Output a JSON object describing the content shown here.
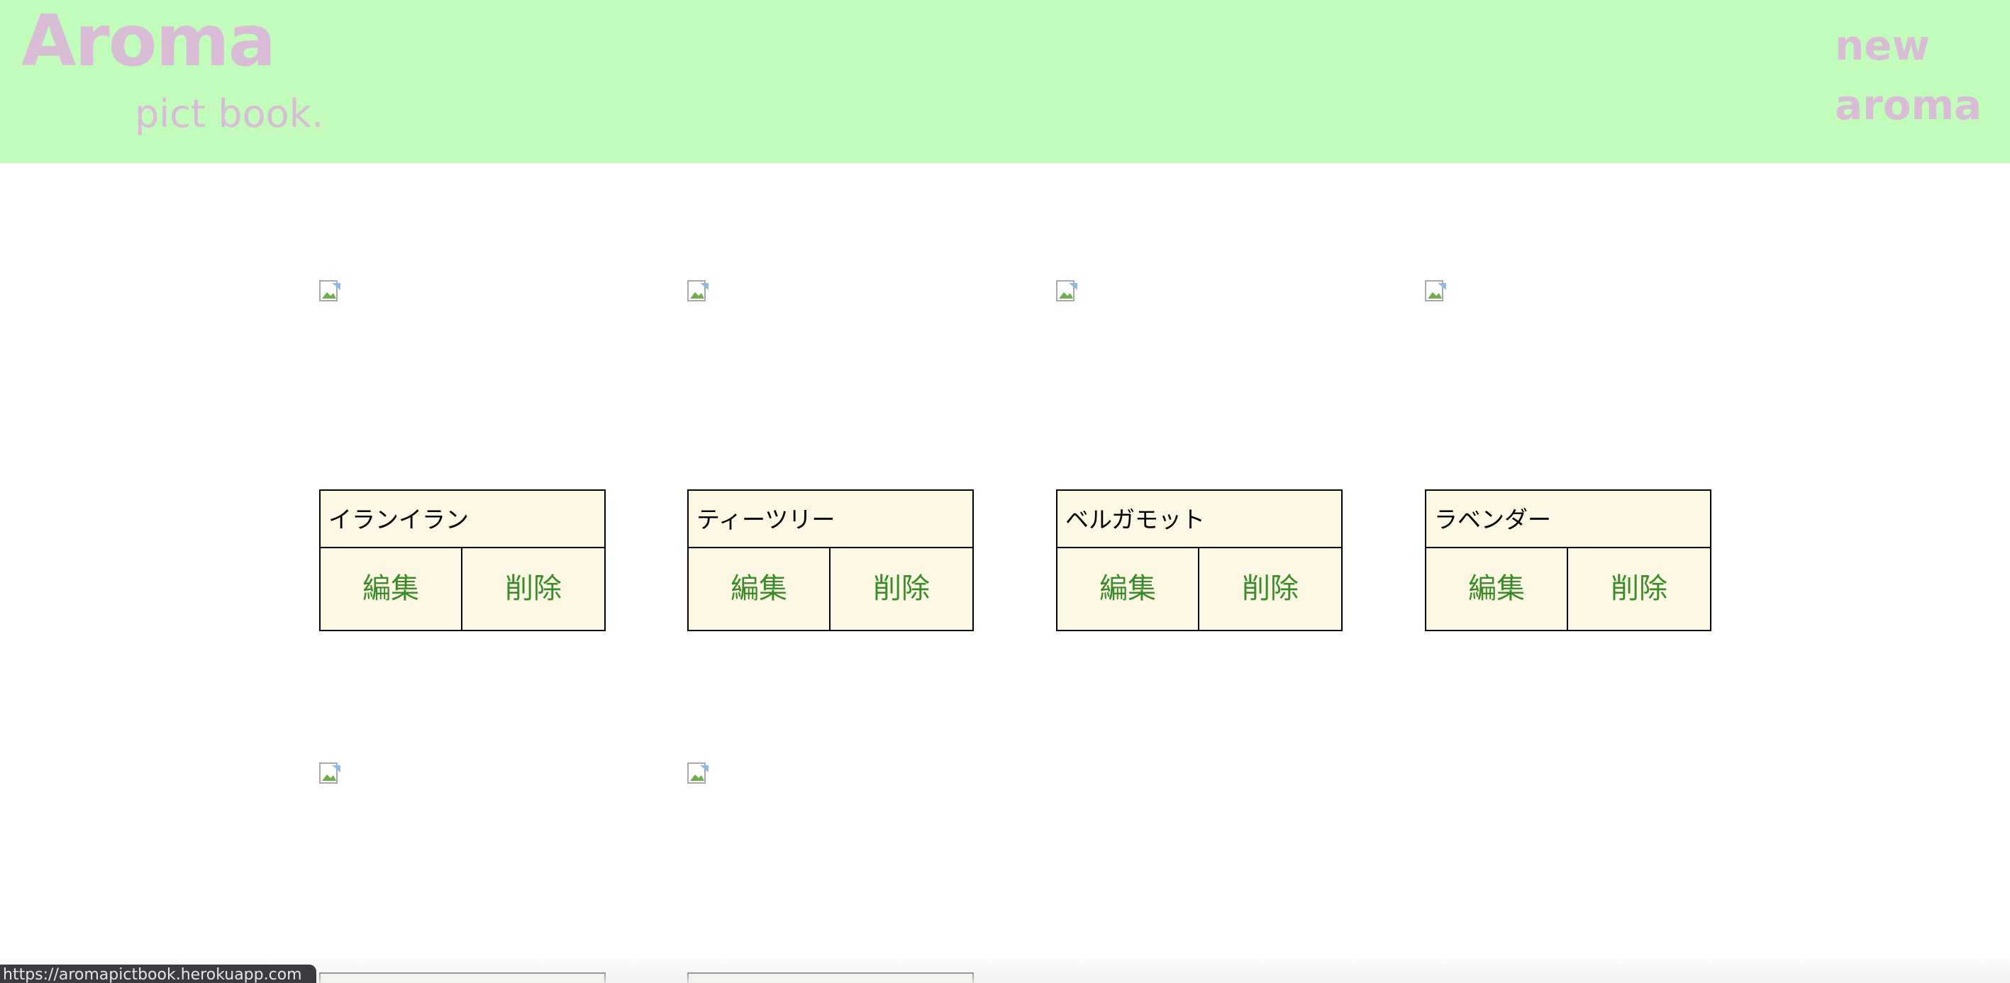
{
  "header": {
    "logo_title": "Aroma",
    "logo_subtitle": "pict book.",
    "new_link_label": "new aroma",
    "background_color": "#c2fcbb",
    "logo_color": "#d9bcd6"
  },
  "cards": [
    {
      "name": "イランイラン",
      "edit_label": "編集",
      "delete_label": "削除"
    },
    {
      "name": "ティーツリー",
      "edit_label": "編集",
      "delete_label": "削除"
    },
    {
      "name": "ベルガモット",
      "edit_label": "編集",
      "delete_label": "削除"
    },
    {
      "name": "ラベンダー",
      "edit_label": "編集",
      "delete_label": "削除"
    }
  ],
  "images": [
    {
      "icon": "broken-image-icon"
    },
    {
      "icon": "broken-image-icon"
    },
    {
      "icon": "broken-image-icon"
    },
    {
      "icon": "broken-image-icon"
    },
    {
      "icon": "broken-image-icon"
    },
    {
      "icon": "broken-image-icon"
    }
  ],
  "status_bar": {
    "url": "https://aromapictbook.herokuapp.com"
  },
  "colors": {
    "card_background": "#fdf8e3",
    "action_text": "#3a8b2a"
  }
}
